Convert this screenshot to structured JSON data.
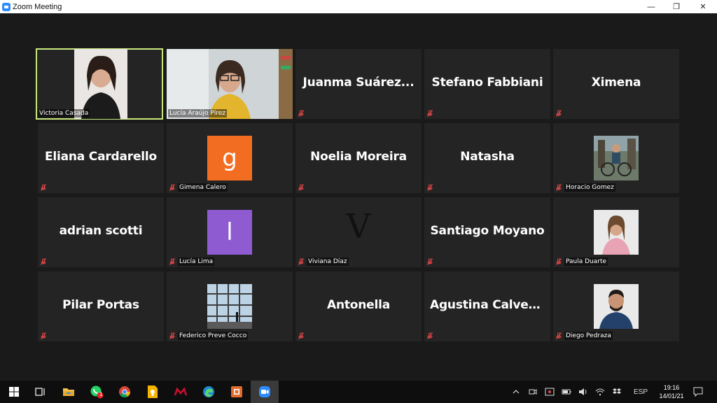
{
  "window": {
    "title": "Zoom Meeting",
    "minimize": "—",
    "restore": "❐",
    "close": "✕"
  },
  "participants": [
    {
      "name": "Victoria Casada",
      "display": "",
      "kind": "video",
      "active": true
    },
    {
      "name": "Lucía Araújo Pírez",
      "display": "",
      "kind": "video",
      "active": false
    },
    {
      "name": "",
      "display": "Juanma  Suárez...",
      "kind": "name",
      "active": false
    },
    {
      "name": "",
      "display": "Stefano Fabbiani",
      "kind": "name",
      "active": false
    },
    {
      "name": "",
      "display": "Ximena",
      "kind": "name",
      "active": false
    },
    {
      "name": "",
      "display": "Eliana Cardarello",
      "kind": "name",
      "active": false
    },
    {
      "name": "Gimena Calero",
      "display": "g",
      "kind": "letter",
      "color": "#f26d21",
      "active": false
    },
    {
      "name": "",
      "display": "Noelia Moreira",
      "kind": "name",
      "active": false
    },
    {
      "name": "",
      "display": "Natasha",
      "kind": "name",
      "active": false
    },
    {
      "name": "Horacio Gomez",
      "display": "",
      "kind": "photo",
      "active": false
    },
    {
      "name": "",
      "display": "adrian scotti",
      "kind": "name",
      "active": false
    },
    {
      "name": "Lucía Lima",
      "display": "l",
      "kind": "letter",
      "color": "#8e5bd1",
      "active": false
    },
    {
      "name": "Viviana Díaz",
      "display": "V",
      "kind": "serif",
      "active": false
    },
    {
      "name": "",
      "display": "Santiago Moyano",
      "kind": "name",
      "active": false
    },
    {
      "name": "Paula Duarte",
      "display": "",
      "kind": "photo",
      "active": false
    },
    {
      "name": "",
      "display": "Pilar Portas",
      "kind": "name",
      "active": false
    },
    {
      "name": "Federico Preve Cocco",
      "display": "",
      "kind": "photo",
      "active": false
    },
    {
      "name": "",
      "display": "Antonella",
      "kind": "name",
      "active": false
    },
    {
      "name": "",
      "display": "Agustina Calvette",
      "kind": "name",
      "active": false
    },
    {
      "name": "Diego Pedraza",
      "display": "",
      "kind": "photo",
      "active": false
    }
  ],
  "taskbar": {
    "apps": [
      "windows-start-icon",
      "task-view-icon",
      "file-explorer-icon",
      "whatsapp-icon",
      "chrome-icon",
      "google-keep-icon",
      "mendeley-icon",
      "edge-icon",
      "powerpoint-icon",
      "zoom-icon"
    ],
    "whatsapp_badge": "1",
    "language": "ESP",
    "time": "19:16",
    "date": "14/01/21"
  }
}
